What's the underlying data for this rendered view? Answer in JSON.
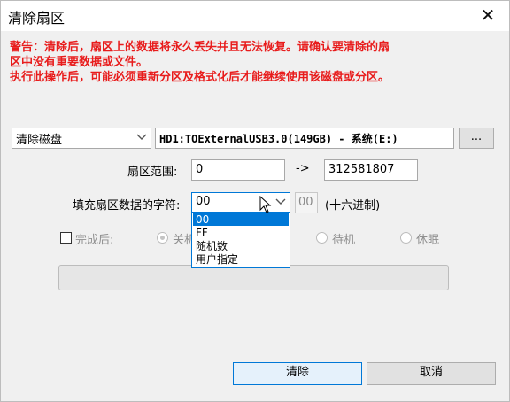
{
  "window": {
    "title": "清除扇区",
    "close_glyph": "✕"
  },
  "warning": {
    "line1": "警告：清除后，扇区上的数据将永久丢失并且无法恢复。请确认要清除的扇",
    "line2": "区中没有重要数据或文件。",
    "line3": "执行此操作后，可能必须重新分区及格式化后才能继续使用该磁盘或分区。"
  },
  "target": {
    "selected": "清除磁盘",
    "disk_info": "HD1:TOExternalUSB3.0(149GB) - 系统(E:)",
    "browse_label": "..."
  },
  "range": {
    "label": "扇区范围:",
    "start": "0",
    "arrow": "->",
    "end": "312581807"
  },
  "fill": {
    "label": "填充扇区数据的字符:",
    "selected": "00",
    "hex_value": "00",
    "hex_note": "(十六进制)",
    "options": [
      "00",
      "FF",
      "随机数",
      "用户指定"
    ]
  },
  "after": {
    "label": "完成后:",
    "checked": false,
    "options": [
      "关机",
      "待机",
      "休眠"
    ]
  },
  "progress": {
    "value": 0
  },
  "buttons": {
    "ok": "清除",
    "cancel": "取消"
  },
  "colors": {
    "warning": "#e81c1c",
    "accent": "#0078d7"
  }
}
